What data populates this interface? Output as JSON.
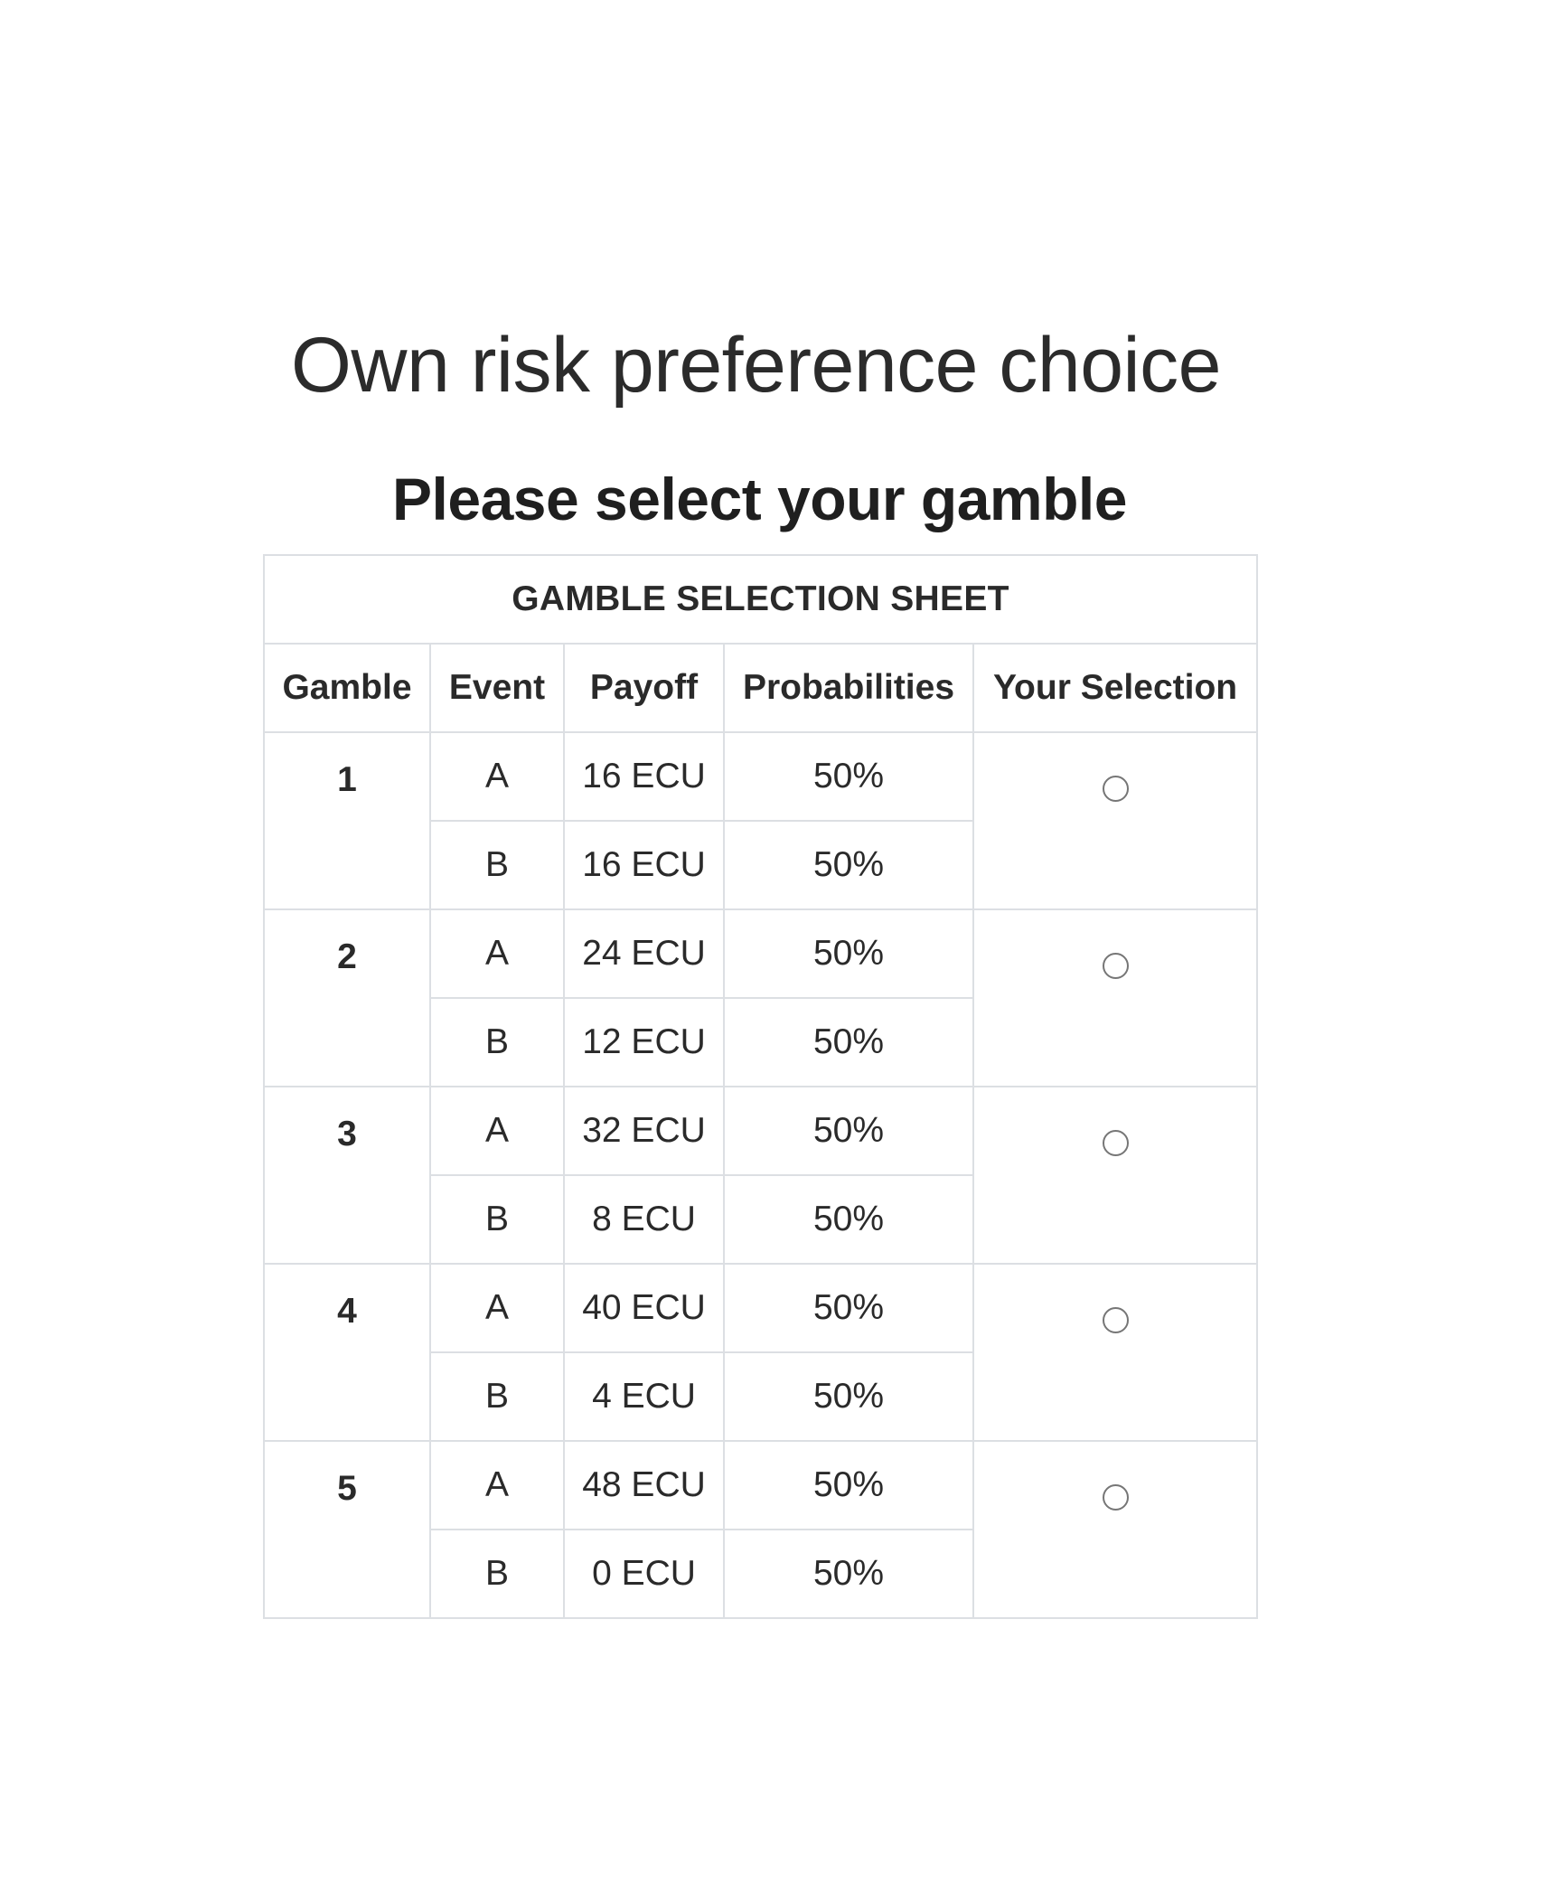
{
  "page": {
    "title": "Own risk preference choice",
    "subtitle": "Please select your gamble"
  },
  "sheet": {
    "caption": "GAMBLE SELECTION SHEET",
    "headers": [
      "Gamble",
      "Event",
      "Payoff",
      "Probabilities",
      "Your Selection"
    ],
    "gambles": [
      {
        "number": "1",
        "events": [
          {
            "event": "A",
            "payoff": "16 ECU",
            "probability": "50%"
          },
          {
            "event": "B",
            "payoff": "16 ECU",
            "probability": "50%"
          }
        ]
      },
      {
        "number": "2",
        "events": [
          {
            "event": "A",
            "payoff": "24 ECU",
            "probability": "50%"
          },
          {
            "event": "B",
            "payoff": "12 ECU",
            "probability": "50%"
          }
        ]
      },
      {
        "number": "3",
        "events": [
          {
            "event": "A",
            "payoff": "32 ECU",
            "probability": "50%"
          },
          {
            "event": "B",
            "payoff": "8 ECU",
            "probability": "50%"
          }
        ]
      },
      {
        "number": "4",
        "events": [
          {
            "event": "A",
            "payoff": "40 ECU",
            "probability": "50%"
          },
          {
            "event": "B",
            "payoff": "4 ECU",
            "probability": "50%"
          }
        ]
      },
      {
        "number": "5",
        "events": [
          {
            "event": "A",
            "payoff": "48 ECU",
            "probability": "50%"
          },
          {
            "event": "B",
            "payoff": "0 ECU",
            "probability": "50%"
          }
        ]
      }
    ],
    "selected": null
  }
}
